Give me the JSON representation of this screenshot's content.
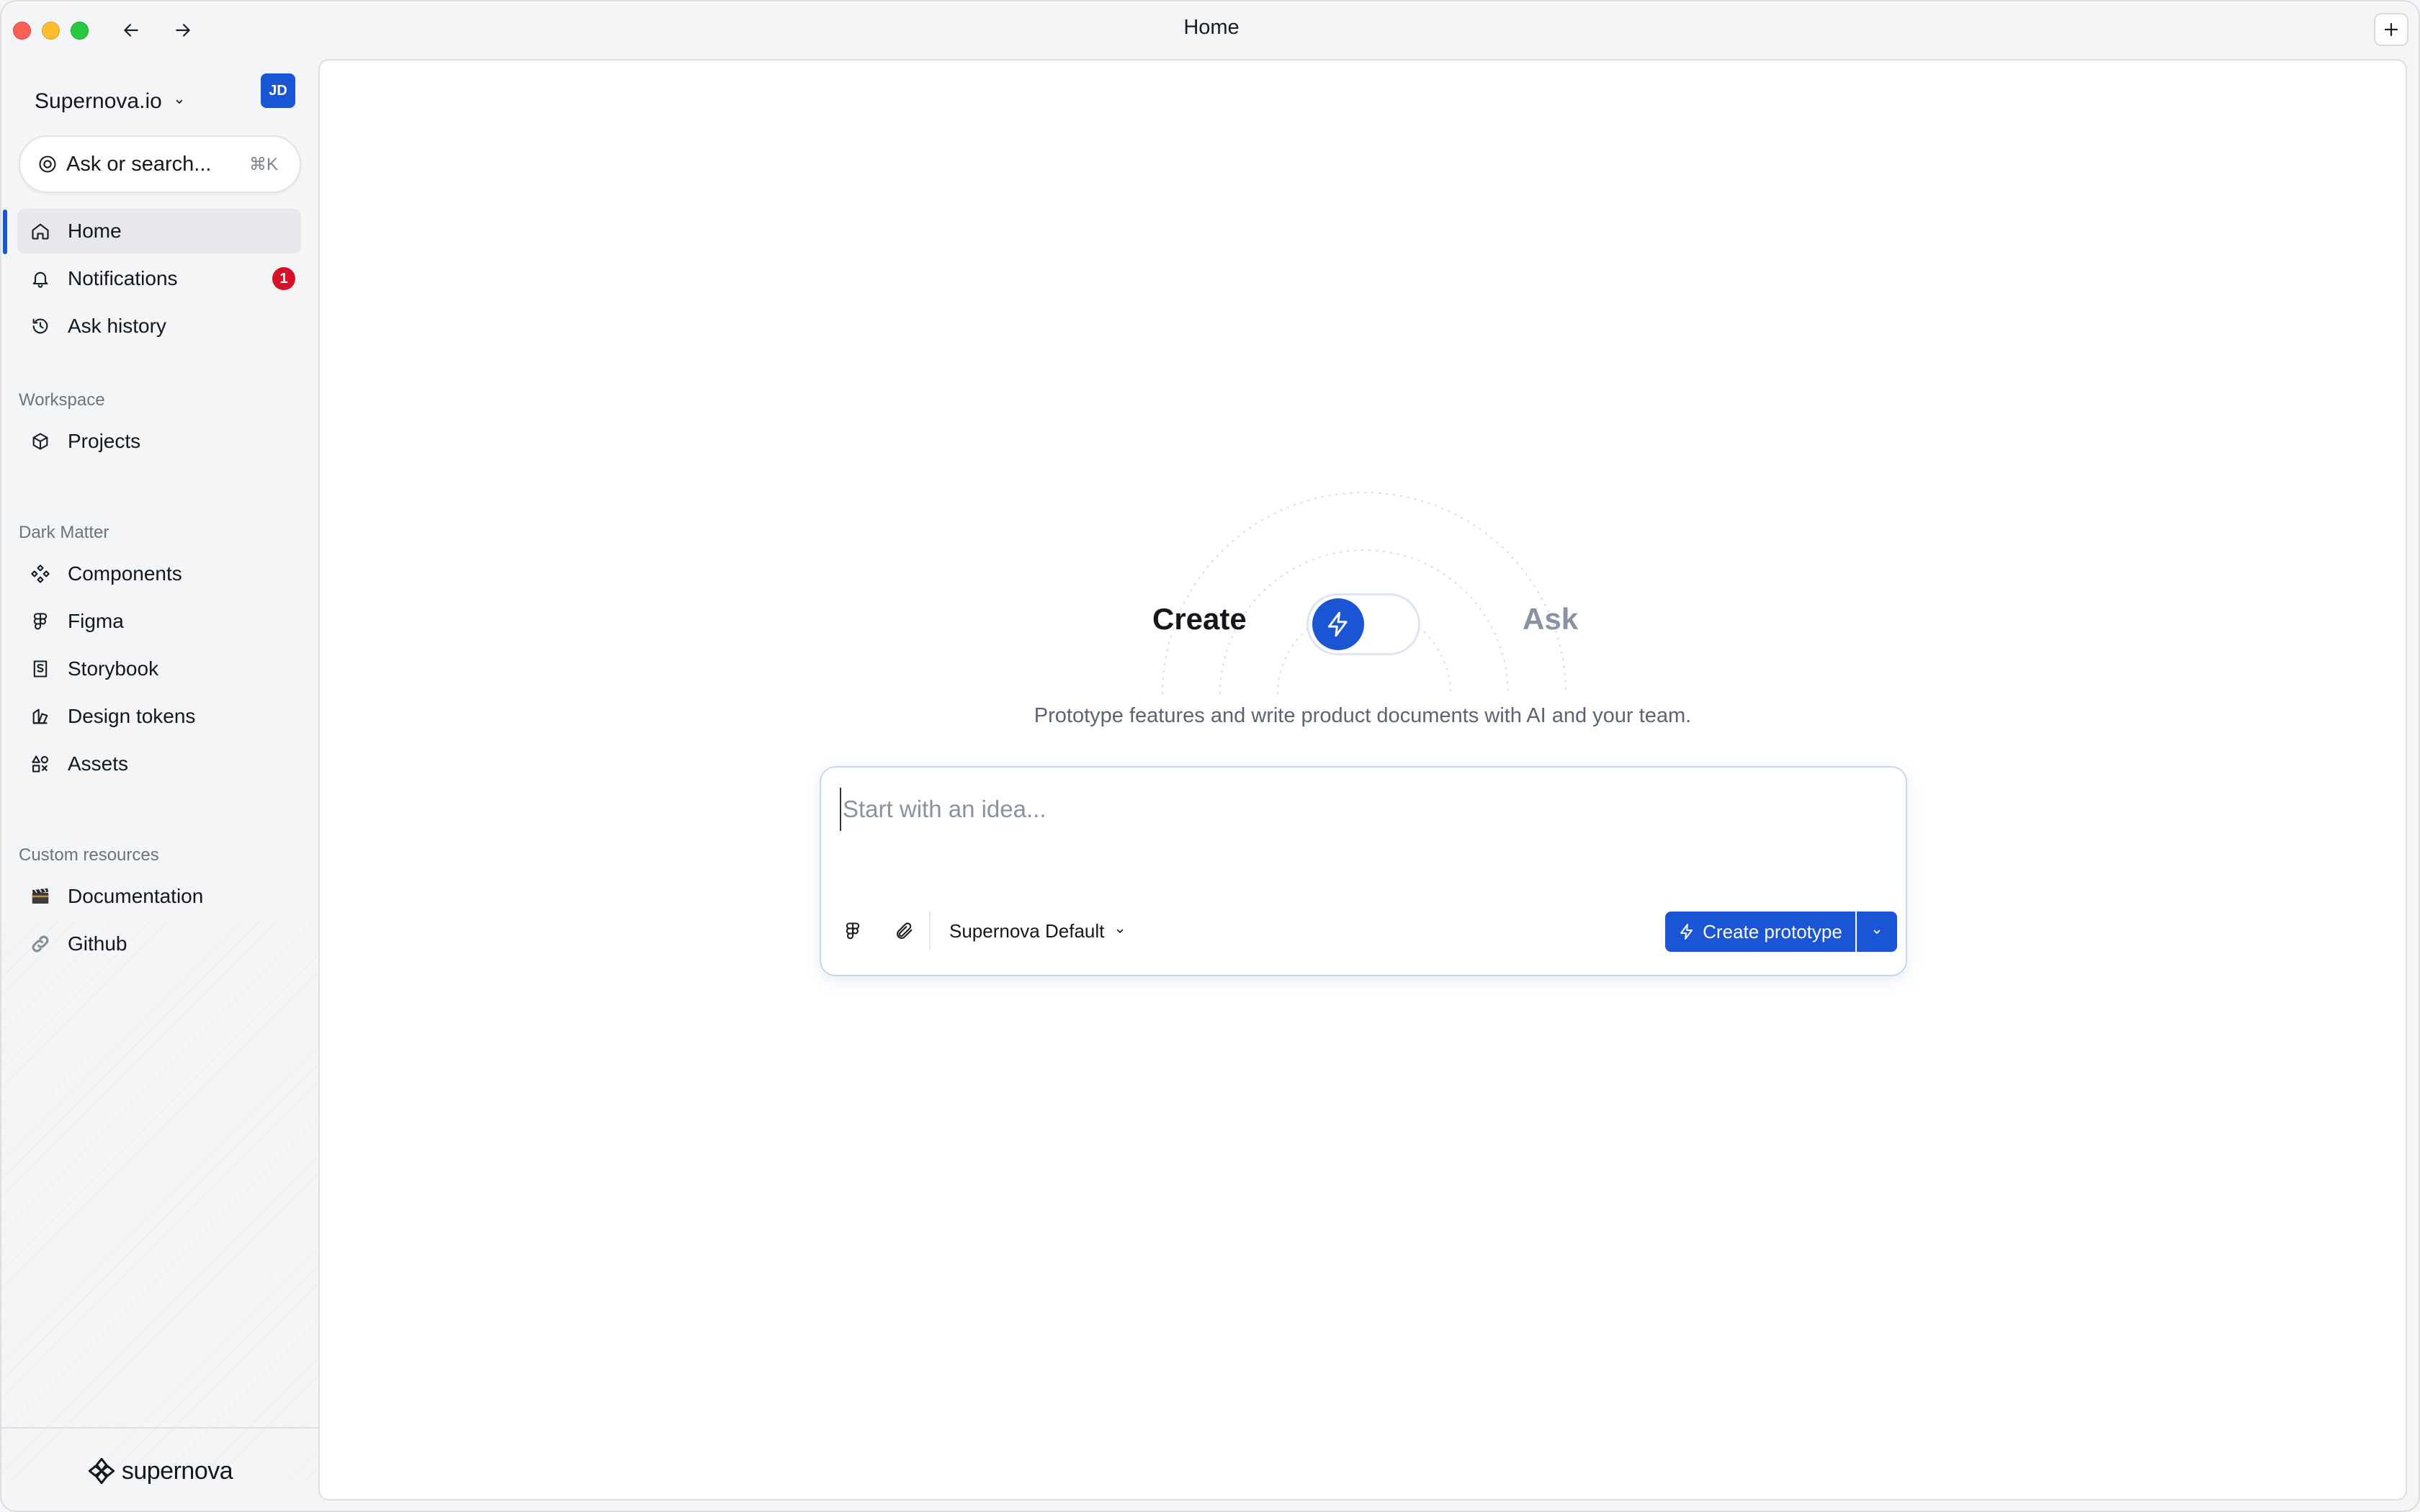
{
  "window": {
    "title": "Home"
  },
  "sidebar": {
    "org_name": "Supernova.io",
    "avatar_initials": "JD",
    "search": {
      "label": "Ask or search...",
      "shortcut": "⌘K"
    },
    "primary_items": [
      {
        "label": "Home",
        "icon": "home-icon",
        "active": true
      },
      {
        "label": "Notifications",
        "icon": "bell-icon",
        "badge": "1"
      },
      {
        "label": "Ask history",
        "icon": "history-icon"
      }
    ],
    "sections": [
      {
        "title": "Workspace",
        "items": [
          {
            "label": "Projects",
            "icon": "cube-icon"
          }
        ]
      },
      {
        "title": "Dark Matter",
        "items": [
          {
            "label": "Components",
            "icon": "components-icon"
          },
          {
            "label": "Figma",
            "icon": "figma-icon"
          },
          {
            "label": "Storybook",
            "icon": "storybook-icon"
          },
          {
            "label": "Design tokens",
            "icon": "design-tokens-icon"
          },
          {
            "label": "Assets",
            "icon": "assets-icon"
          }
        ]
      },
      {
        "title": "Custom resources",
        "items": [
          {
            "label": "Documentation",
            "icon": "clapperboard-emoji-icon"
          },
          {
            "label": "Github",
            "icon": "link-emoji-icon"
          }
        ]
      }
    ],
    "brand": "supernova"
  },
  "main": {
    "mode": {
      "create_label": "Create",
      "ask_label": "Ask",
      "selected": "Create"
    },
    "subtitle": "Prototype features and write product documents with AI and your team.",
    "prompt": {
      "placeholder": "Start with an idea...",
      "model": "Supernova Default",
      "submit_label": "Create prototype"
    }
  },
  "colors": {
    "accent": "#1a55d6",
    "badge": "#d8112b",
    "sidebar_bg": "#f4f5f7"
  }
}
